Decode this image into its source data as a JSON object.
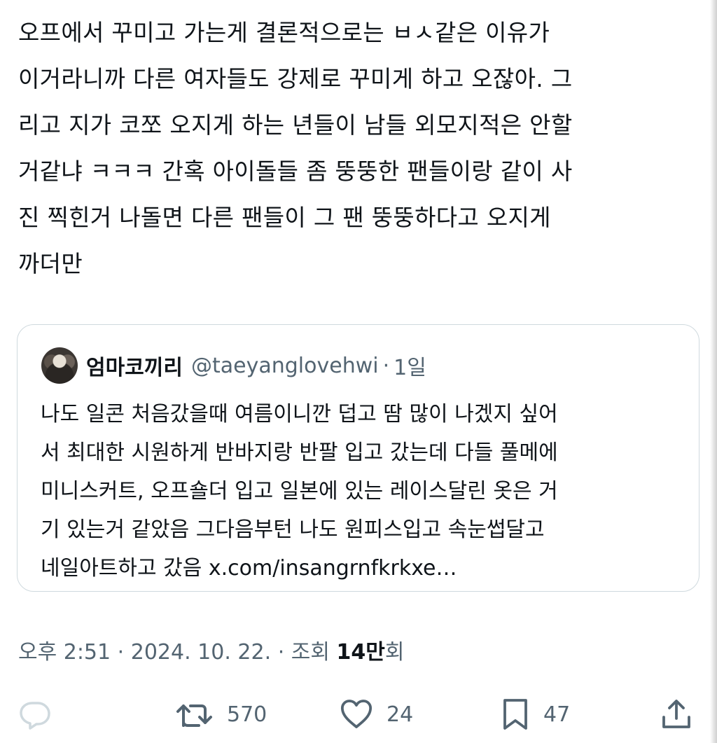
{
  "tweet": {
    "text": "오프에서 꾸미고 가는게 결론적으로는 ㅂㅅ같은 이유가\n이거라니까 다른 여자들도 강제로 꾸미게 하고 오잖아. 그\n리고 지가 코쪼 오지게 하는 년들이 남들 외모지적은 안할\n거같냐 ㅋㅋㅋ 간혹 아이돌들 좀 뚱뚱한 팬들이랑 같이 사\n진 찍힌거 나돌면 다른 팬들이 그 팬 뚱뚱하다고 오지게\n까더만"
  },
  "quote": {
    "avatar": "avatar-photo",
    "display_name": "엄마코끼리",
    "handle": "@taeyanglovehwi",
    "separator": "·",
    "time": "1일",
    "text": "나도 일콘 처음갔을때 여름이니깐 덥고 땀 많이 나겠지 싶어\n서 최대한 시원하게 반바지랑 반팔 입고 갔는데 다들 풀메에\n미니스커트, 오프숄더 입고 일본에 있는 레이스달린 옷은 거\n기 있는거 같았음 그다음부턴 나도 원피스입고 속눈썹달고\n네일아트하고 갔음 x.com/insangrnfkrkxe…"
  },
  "meta": {
    "time": "오후 2:51",
    "separator": "·",
    "date": "2024. 10. 22.",
    "views_label": "조회",
    "views_count": "14만",
    "views_suffix": "회"
  },
  "actions": {
    "reply": {
      "icon": "reply-icon",
      "count": ""
    },
    "retweet": {
      "icon": "retweet-icon",
      "count": "570"
    },
    "like": {
      "icon": "heart-icon",
      "count": "24"
    },
    "bookmark": {
      "icon": "bookmark-icon",
      "count": "47"
    },
    "share": {
      "icon": "share-icon"
    }
  },
  "colors": {
    "text": "#0f1419",
    "secondary": "#536471",
    "border": "#cfd9de",
    "reply_icon": "#cfd9de"
  }
}
